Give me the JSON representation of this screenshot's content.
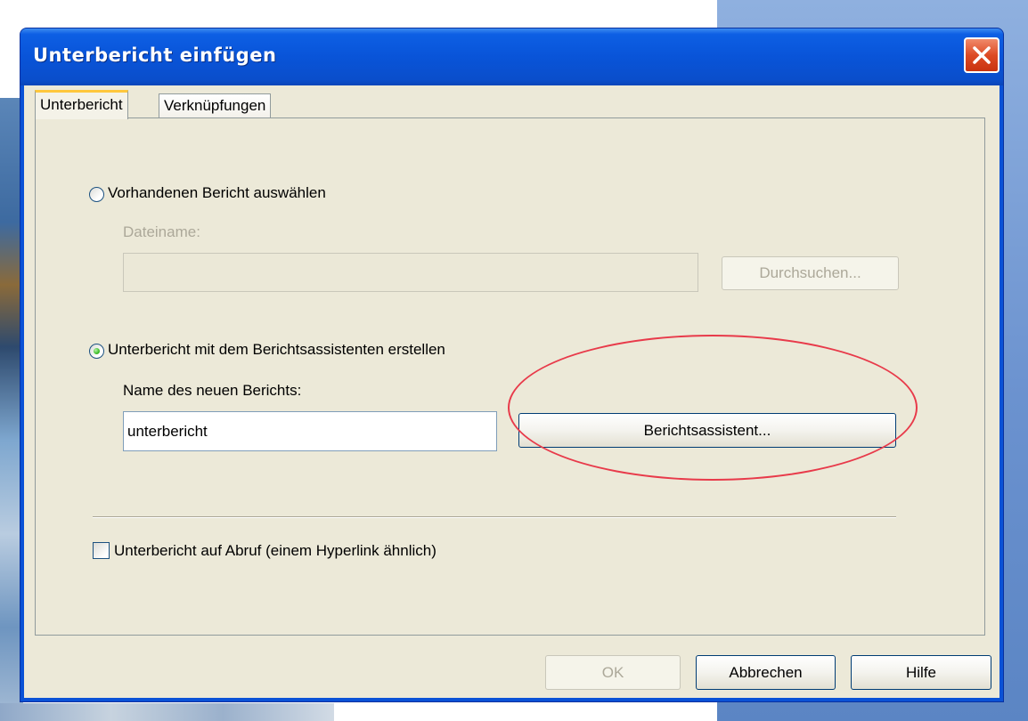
{
  "dialog": {
    "title": "Unterbericht einfügen",
    "tabs": [
      {
        "label": "Unterbericht",
        "active": true
      },
      {
        "label": "Verknüpfungen",
        "active": false
      }
    ],
    "option_existing": {
      "label": "Vorhandenen Bericht auswählen",
      "selected": false,
      "filename_label": "Dateiname:",
      "filename_value": "",
      "browse_label": "Durchsuchen..."
    },
    "option_wizard": {
      "label": "Unterbericht mit dem Berichtsassistenten erstellen",
      "selected": true,
      "name_label": "Name des neuen Berichts:",
      "name_value": "unterbericht",
      "wizard_button_label": "Berichtsassistent..."
    },
    "on_demand": {
      "label": "Unterbericht auf Abruf (einem Hyperlink ähnlich)",
      "checked": false
    },
    "buttons": {
      "ok": "OK",
      "cancel": "Abbrechen",
      "help": "Hilfe"
    }
  },
  "colors": {
    "titlebar": "#0a52d6",
    "dialog_face": "#ece9d8",
    "annotation": "#e83a4a"
  }
}
